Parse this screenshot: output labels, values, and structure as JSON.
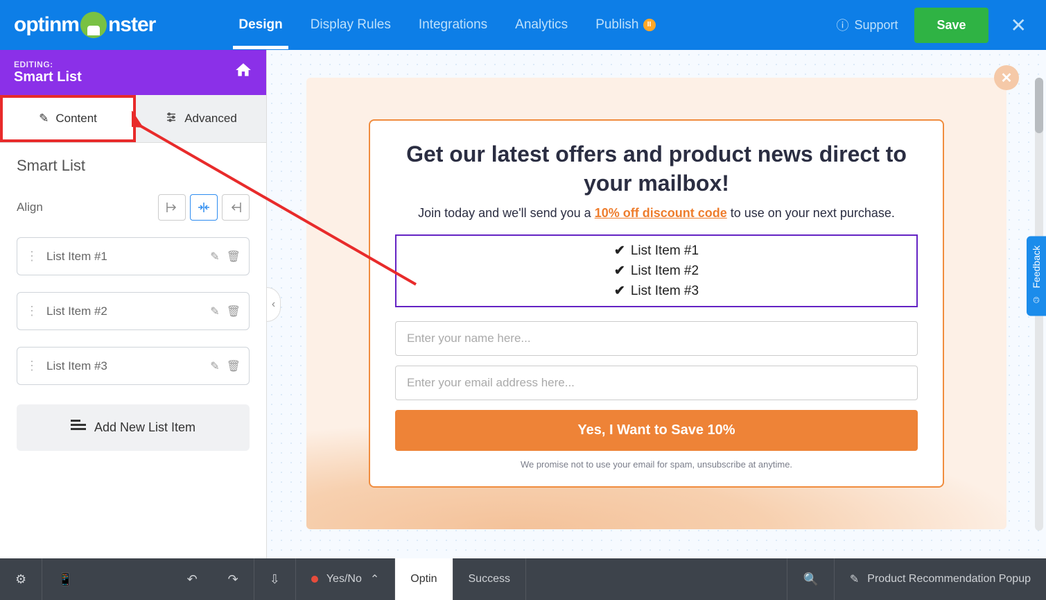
{
  "brand": "optinmonster",
  "nav": {
    "items": [
      "Design",
      "Display Rules",
      "Integrations",
      "Analytics",
      "Publish"
    ],
    "active": "Design"
  },
  "support_label": "Support",
  "save_label": "Save",
  "sidebar": {
    "editing_label": "EDITING:",
    "editing_title": "Smart List",
    "tabs": {
      "content": "Content",
      "advanced": "Advanced"
    },
    "panel_title": "Smart List",
    "align_label": "Align",
    "items": [
      {
        "label": "List Item #1"
      },
      {
        "label": "List Item #2"
      },
      {
        "label": "List Item #3"
      }
    ],
    "add_label": "Add New List Item"
  },
  "popup": {
    "title": "Get our latest offers and product news direct to your mailbox!",
    "sub_pre": "Join today and we'll send you a ",
    "sub_link": "10% off discount code",
    "sub_post": " to use on your next purchase.",
    "list": [
      "List Item #1",
      "List Item #2",
      "List Item #3"
    ],
    "name_placeholder": "Enter your name here...",
    "email_placeholder": "Enter your email address here...",
    "cta": "Yes, I Want to Save 10%",
    "disclaimer": "We promise not to use your email for spam, unsubscribe at anytime."
  },
  "feedback_label": "Feedback",
  "bottombar": {
    "yesno": "Yes/No",
    "optin": "Optin",
    "success": "Success",
    "campaign": "Product Recommendation Popup"
  }
}
